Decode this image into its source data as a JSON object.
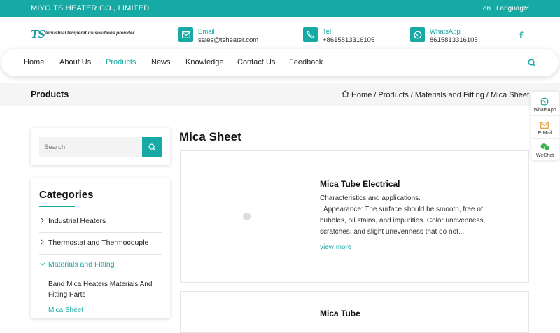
{
  "topbar": {
    "company": "MIYO TS HEATER CO., LIMITED",
    "lang_code": "en",
    "language": "Language"
  },
  "logo": {
    "mark": "TS",
    "tagline": "Industrial temperature solutions provider"
  },
  "contacts": {
    "email": {
      "label": "Email",
      "value": "sales@tsheater.com",
      "icon": "mail-icon"
    },
    "tel": {
      "label": "Tel",
      "value": "+8615813316105",
      "icon": "phone-icon"
    },
    "whatsapp": {
      "label": "WhatsApp",
      "value": "8615813316105",
      "icon": "whatsapp-icon"
    }
  },
  "social": {
    "facebook": "f"
  },
  "nav": {
    "items": [
      "Home",
      "About Us",
      "Products",
      "News",
      "Knowledge",
      "Contact Us",
      "Feedback"
    ],
    "active": "Products"
  },
  "breadcrumb": {
    "title": "Products",
    "items": [
      "Home",
      "Products",
      "Materials and Fitting",
      "Mica Sheet"
    ],
    "sep": "/"
  },
  "sidebar": {
    "search_placeholder": "Search",
    "categories_title": "Categories",
    "categories": [
      "Industrial Heaters",
      "Thermostat and Thermocouple",
      "Materials and Fitting"
    ],
    "subcategories": [
      "Band Mica Heaters Materials And Fitting Parts",
      "Mica Sheet"
    ]
  },
  "main": {
    "title": "Mica Sheet",
    "products": [
      {
        "name": "Mica Tube Electrical",
        "desc_line1": "Characteristics and applications.",
        "desc_line2": ", Appearance: The surface should be smooth, free of bubbles, oil stains, and impurities. Color unevenness, scratches, and slight unevenness that do not...",
        "more": "view more"
      },
      {
        "name": "Mica Tube"
      }
    ]
  },
  "float": {
    "items": [
      "WhatsApp",
      "E-Mail",
      "WeChat"
    ]
  },
  "colors": {
    "accent": "#17a9a3"
  }
}
